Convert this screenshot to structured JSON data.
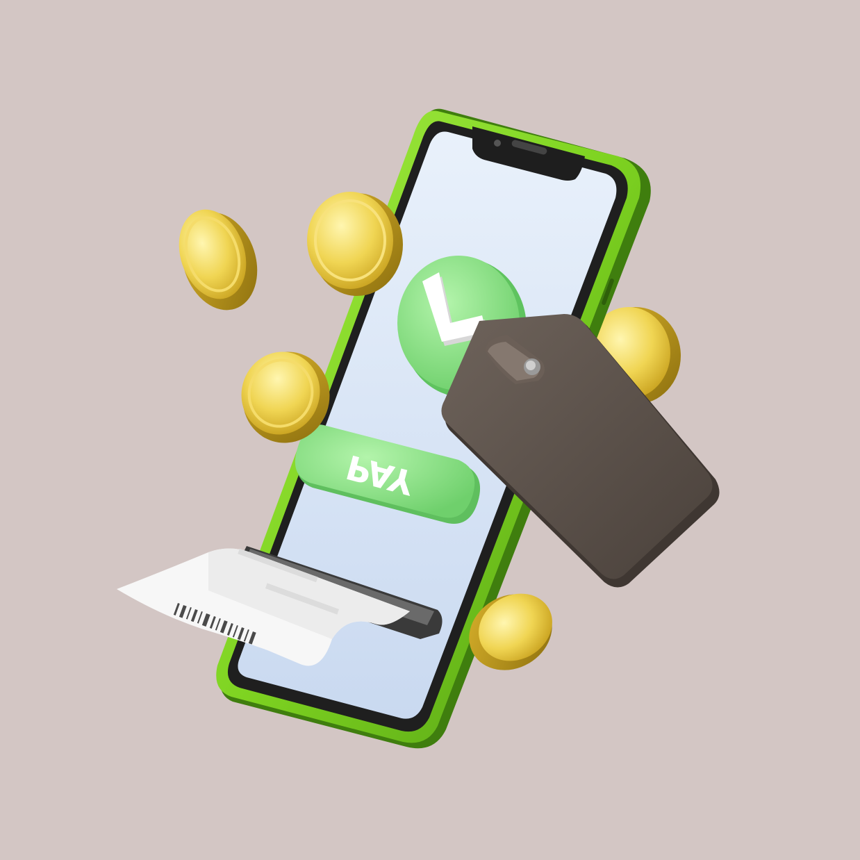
{
  "scene": {
    "background": "#d3c6c4",
    "colors": {
      "phone_frame": "#7ed321",
      "phone_frame_dark": "#4f9a12",
      "screen": "#dde9f7",
      "notch": "#1e1e1e",
      "check_button": "#8ee68a",
      "check_button_shade": "#5fc35f",
      "pay_button": "#93e58e",
      "pay_button_shade": "#62c161",
      "coin": "#e6c63a",
      "coin_edge": "#a88714",
      "wallet": "#5e534c",
      "receipt": "#f7f7f7"
    },
    "icons": {
      "check": "checkmark-icon",
      "wallet": "wallet-icon",
      "coin": "coin-icon",
      "receipt": "receipt-icon"
    }
  },
  "phone": {
    "pay_button_label": "PAY"
  }
}
